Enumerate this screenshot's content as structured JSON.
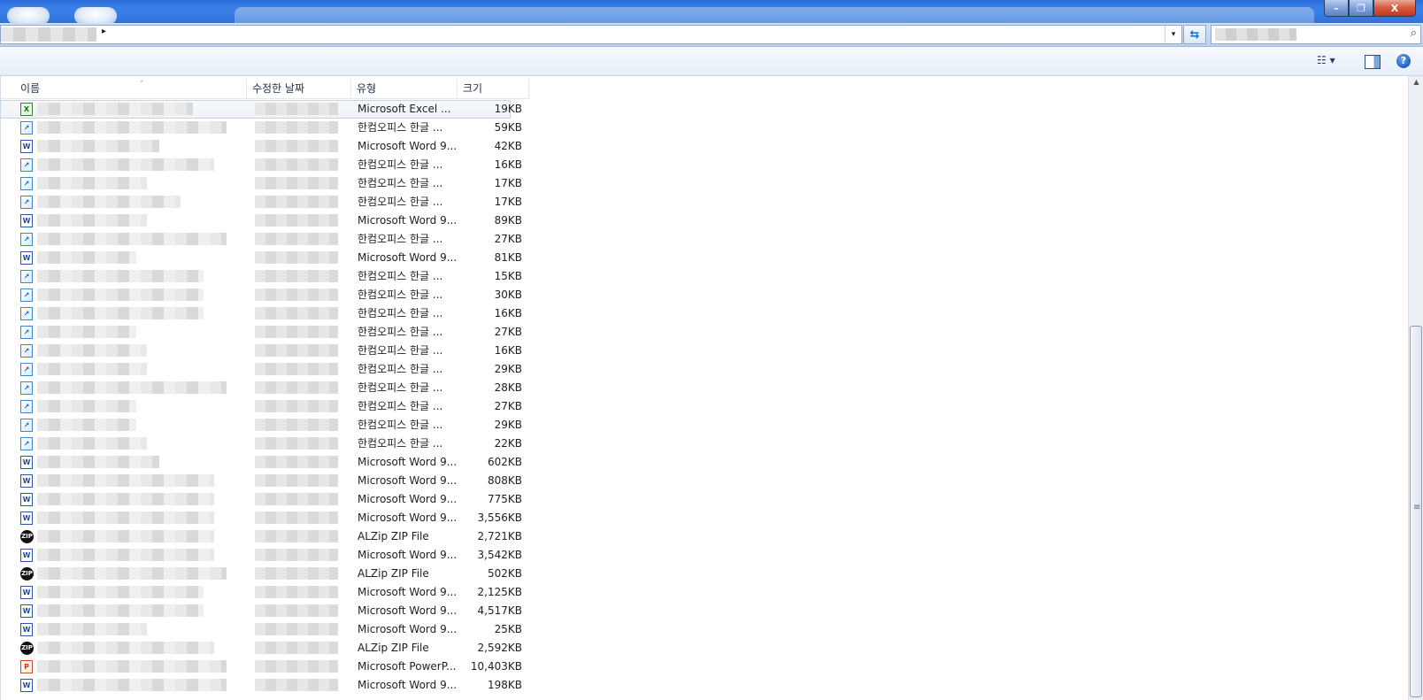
{
  "window": {
    "minimize_label": "–",
    "maximize_label": "❐",
    "close_label": "X"
  },
  "address": {
    "separator": "▸",
    "dropdown": "▾",
    "refresh": "⇆",
    "search_icon": "⌕"
  },
  "commandbar": {
    "views_label": "☷ ▾",
    "help_label": "?"
  },
  "columns": {
    "name": "이름",
    "date": "수정한 날짜",
    "type": "유형",
    "size": "크기",
    "sort_indicator": "ˆ"
  },
  "files": [
    {
      "icon": "excel",
      "type": "Microsoft Excel ...",
      "size": "19KB"
    },
    {
      "icon": "hwp",
      "type": "한컴오피스 한글 ...",
      "size": "59KB"
    },
    {
      "icon": "word",
      "type": "Microsoft Word 9...",
      "size": "42KB"
    },
    {
      "icon": "hwp",
      "type": "한컴오피스 한글 ...",
      "size": "16KB"
    },
    {
      "icon": "hwp",
      "type": "한컴오피스 한글 ...",
      "size": "17KB"
    },
    {
      "icon": "hwp",
      "type": "한컴오피스 한글 ...",
      "size": "17KB"
    },
    {
      "icon": "word",
      "type": "Microsoft Word 9...",
      "size": "89KB"
    },
    {
      "icon": "hwp",
      "type": "한컴오피스 한글 ...",
      "size": "27KB"
    },
    {
      "icon": "word",
      "type": "Microsoft Word 9...",
      "size": "81KB"
    },
    {
      "icon": "hwp",
      "type": "한컴오피스 한글 ...",
      "size": "15KB"
    },
    {
      "icon": "hwp",
      "type": "한컴오피스 한글 ...",
      "size": "30KB"
    },
    {
      "icon": "hwp",
      "type": "한컴오피스 한글 ...",
      "size": "16KB"
    },
    {
      "icon": "hwp",
      "type": "한컴오피스 한글 ...",
      "size": "27KB"
    },
    {
      "icon": "hwp",
      "type": "한컴오피스 한글 ...",
      "size": "16KB"
    },
    {
      "icon": "hwp",
      "type": "한컴오피스 한글 ...",
      "size": "29KB"
    },
    {
      "icon": "hwp",
      "type": "한컴오피스 한글 ...",
      "size": "28KB"
    },
    {
      "icon": "hwp",
      "type": "한컴오피스 한글 ...",
      "size": "27KB"
    },
    {
      "icon": "hwp",
      "type": "한컴오피스 한글 ...",
      "size": "29KB"
    },
    {
      "icon": "hwp",
      "type": "한컴오피스 한글 ...",
      "size": "22KB"
    },
    {
      "icon": "word",
      "type": "Microsoft Word 9...",
      "size": "602KB"
    },
    {
      "icon": "word",
      "type": "Microsoft Word 9...",
      "size": "808KB"
    },
    {
      "icon": "word",
      "type": "Microsoft Word 9...",
      "size": "775KB"
    },
    {
      "icon": "word",
      "type": "Microsoft Word 9...",
      "size": "3,556KB"
    },
    {
      "icon": "zip",
      "type": "ALZip ZIP File",
      "size": "2,721KB"
    },
    {
      "icon": "word",
      "type": "Microsoft Word 9...",
      "size": "3,542KB"
    },
    {
      "icon": "zip",
      "type": "ALZip ZIP File",
      "size": "502KB"
    },
    {
      "icon": "word",
      "type": "Microsoft Word 9...",
      "size": "2,125KB"
    },
    {
      "icon": "word",
      "type": "Microsoft Word 9...",
      "size": "4,517KB"
    },
    {
      "icon": "word",
      "type": "Microsoft Word 9...",
      "size": "25KB"
    },
    {
      "icon": "zip",
      "type": "ALZip ZIP File",
      "size": "2,592KB"
    },
    {
      "icon": "ppt",
      "type": "Microsoft PowerP...",
      "size": "10,403KB"
    },
    {
      "icon": "word",
      "type": "Microsoft Word 9...",
      "size": "198KB"
    }
  ],
  "icon_glyphs": {
    "excel": "X",
    "hwp": "↗",
    "word": "W",
    "zip": "ZIP",
    "ppt": "P"
  },
  "scrollbar": {
    "up_arrow": "▲",
    "grip": "≡"
  }
}
